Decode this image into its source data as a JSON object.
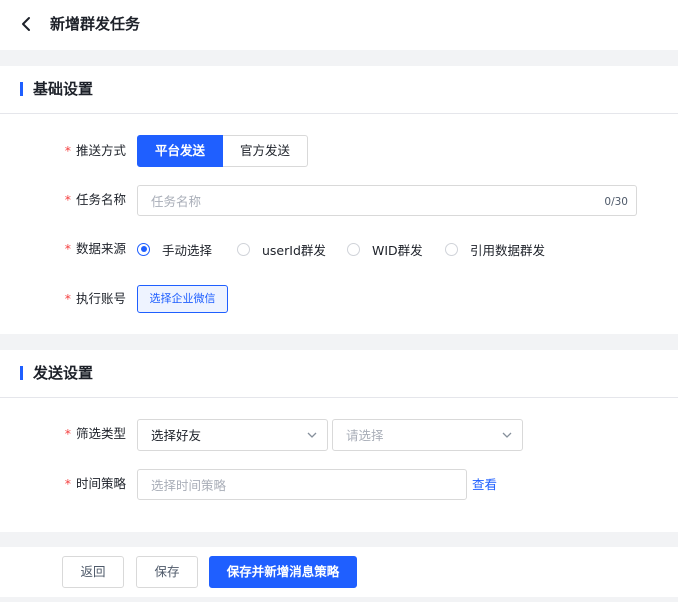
{
  "header": {
    "title": "新增群发任务"
  },
  "basic": {
    "title": "基础设置",
    "send_method": {
      "required_mark": "*",
      "label": "推送方式",
      "options": [
        "平台发送",
        "官方发送"
      ],
      "selected": "平台发送"
    },
    "task_name": {
      "required_mark": "*",
      "label": "任务名称",
      "placeholder": "任务名称",
      "counter": "0/30"
    },
    "data_source": {
      "required_mark": "*",
      "label": "数据来源",
      "options": [
        "手动选择",
        "userId群发",
        "WID群发",
        "引用数据群发"
      ],
      "selected": "手动选择"
    },
    "account": {
      "required_mark": "*",
      "label": "执行账号",
      "button": "选择企业微信"
    }
  },
  "send": {
    "title": "发送设置",
    "filter_type": {
      "required_mark": "*",
      "label": "筛选类型",
      "value": "选择好友",
      "second_placeholder": "请选择"
    },
    "time_strategy": {
      "required_mark": "*",
      "label": "时间策略",
      "placeholder": "选择时间策略",
      "link": "查看"
    }
  },
  "footer": {
    "back": "返回",
    "save": "保存",
    "save_new": "保存并新增消息策略"
  },
  "colors": {
    "primary": "#1f5fff",
    "required": "#f53f3f"
  }
}
